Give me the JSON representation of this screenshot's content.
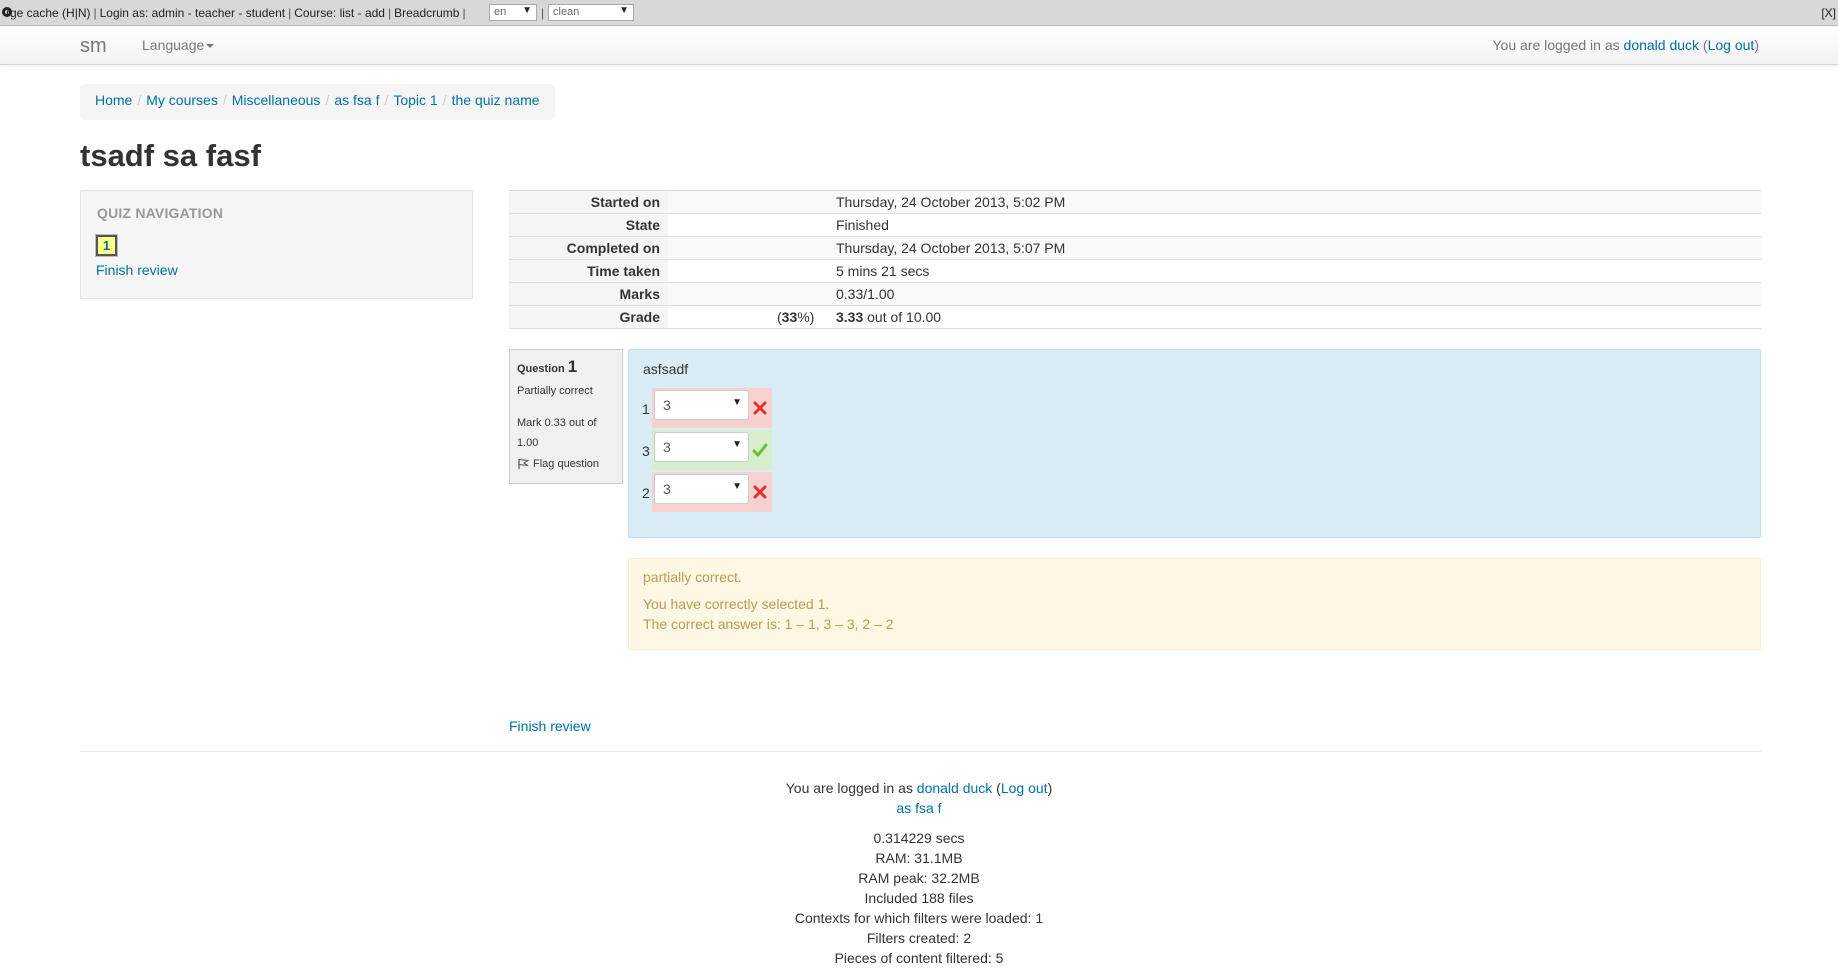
{
  "devbar": {
    "text_purge": "rge cache (H|N)",
    "login_as_label": "Login as:",
    "login_admin": "admin",
    "login_teacher": "teacher",
    "login_student": "student",
    "course_label": "Course:",
    "course_list": "list",
    "course_add": "add",
    "breadcrumb_label": "Breadcrumb",
    "lang_value": "en",
    "theme_value": "clean",
    "close": "[X]"
  },
  "navbar": {
    "brand": "sm",
    "language_menu": "Language",
    "logged_in_prefix": "You are logged in as",
    "user_name": "donald duck",
    "logout": "Log out"
  },
  "breadcrumb": [
    "Home",
    "My courses",
    "Miscellaneous",
    "as fsa f",
    "Topic 1",
    "the quiz name"
  ],
  "page_title": "tsadf sa fasf",
  "quiz_nav": {
    "title": "QUIZ NAVIGATION",
    "question_button": "1",
    "finish_review": "Finish review"
  },
  "summary": [
    {
      "label": "Started on",
      "value": "Thursday, 24 October 2013, 5:02 PM"
    },
    {
      "label": "State",
      "value": "Finished"
    },
    {
      "label": "Completed on",
      "value": "Thursday, 24 October 2013, 5:07 PM"
    },
    {
      "label": "Time taken",
      "value": "5 mins 21 secs"
    },
    {
      "label": "Marks",
      "value": "0.33/1.00"
    }
  ],
  "grade": {
    "label": "Grade",
    "score": "3.33",
    "out_of": "out of 10.00",
    "percent": "33"
  },
  "question": {
    "label": "Question",
    "number": "1",
    "state": "Partially correct",
    "mark_text": "Mark 0.33 out of 1.00",
    "flag": "Flag question",
    "text": "asfsadf",
    "answers": [
      {
        "number": "1",
        "selected": "3",
        "status": "incorrect"
      },
      {
        "number": "3",
        "selected": "3",
        "status": "correct"
      },
      {
        "number": "2",
        "selected": "3",
        "status": "incorrect"
      }
    ]
  },
  "feedback": {
    "specific": "partially correct.",
    "num_right": "You have correctly selected 1.",
    "right_answer": "The correct answer is: 1 – 1, 3 – 3, 2 – 2"
  },
  "finish_review_bottom": "Finish review",
  "footer": {
    "logged_in_prefix": "You are logged in as",
    "user_name": "donald duck",
    "logout": "Log out",
    "course_link": "as fsa f",
    "perf": [
      "0.314229 secs",
      "RAM: 31.1MB",
      "RAM peak: 32.2MB",
      "Included 188 files",
      "Contexts for which filters were loaded: 1",
      "Filters created: 2",
      "Pieces of content filtered: 5"
    ]
  },
  "colors": {
    "link": "#0070a8",
    "incorrect_bg": "#f7d0d0",
    "correct_bg": "#d6eecc",
    "formulation_bg": "#d9ecf5",
    "feedback_bg": "#fcf8e3",
    "feedback_text": "#c09853"
  }
}
